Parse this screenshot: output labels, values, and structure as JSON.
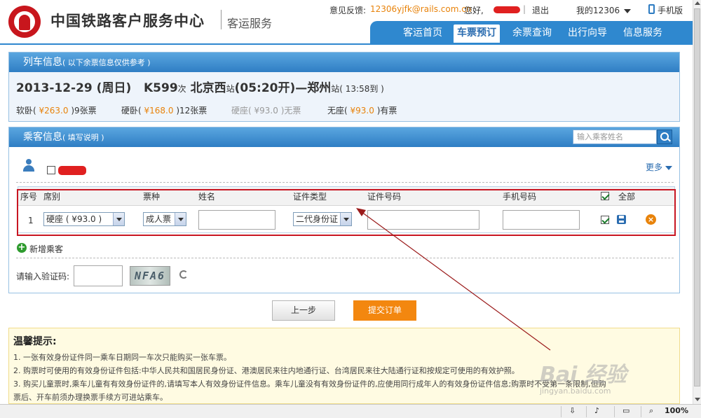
{
  "header": {
    "site_title": "中国铁路客户服务中心",
    "site_subtitle": "客运服务",
    "feedback_label": "意见反馈:",
    "feedback_email": "12306yjfk@rails.com.cn",
    "greeting": "您好,",
    "logout": "退出",
    "my12306": "我的12306",
    "mobile": "手机版",
    "nav": [
      "客运首页",
      "车票预订",
      "余票查询",
      "出行向导",
      "信息服务"
    ],
    "active_nav": "车票预订"
  },
  "train_panel": {
    "title": "列车信息",
    "title_note": "( 以下余票信息仅供参考 )",
    "date": "2013-12-29",
    "weekday": "(周日)",
    "train_no": "K599",
    "train_suffix": "次",
    "from_station": "北京西",
    "station_suffix": "站",
    "depart_time": "(05:20开)",
    "dash": "—",
    "to_station": "郑州",
    "arrive_time": "( 13:58到 )",
    "seats": [
      {
        "name": "软卧",
        "price": "¥263.0",
        "avail": "9张票",
        "available": true
      },
      {
        "name": "硬卧",
        "price": "¥168.0",
        "avail": "12张票",
        "available": true
      },
      {
        "name": "硬座",
        "price": "¥93.0",
        "avail": "无票",
        "available": false
      },
      {
        "name": "无座",
        "price": "¥93.0",
        "avail": "有票",
        "available": true
      }
    ]
  },
  "passenger_panel": {
    "title": "乘客信息",
    "title_note": "( 填写说明 )",
    "search_placeholder": "输入乘客姓名",
    "more": "更多",
    "columns": [
      "序号",
      "席别",
      "票种",
      "姓名",
      "证件类型",
      "证件号码",
      "手机号码",
      "全部"
    ],
    "row": {
      "index": "1",
      "seat": "硬座 ( ¥93.0 )",
      "ticket_type": "成人票",
      "id_type": "二代身份证"
    },
    "add_passenger": "新增乘客",
    "captcha_label": "请输入验证码:",
    "captcha_text": "NFA6"
  },
  "buttons": {
    "prev": "上一步",
    "submit": "提交订单"
  },
  "tips": {
    "title": "温馨提示:",
    "items": [
      "1. 一张有效身份证件同一乘车日期同一车次只能购买一张车票。",
      "2. 购票时可使用的有效身份证件包括:中华人民共和国居民身份证、港澳居民来往内地通行证、台湾居民来往大陆通行证和按规定可使用的有效护照。",
      "3. 购买儿童票时,乘车儿童有有效身份证件的,请填写本人有效身份证件信息。乘车儿童没有有效身份证件的,应使用同行成年人的有效身份证件信息;购票时不受第一条限制,但购",
      "票后、开车前须办理换票手续方可进站乘车。"
    ]
  },
  "watermark": {
    "text": "Bai 经验",
    "sub": "jingyan.baidu.com"
  },
  "statusbar": {
    "zoom": "100%"
  }
}
